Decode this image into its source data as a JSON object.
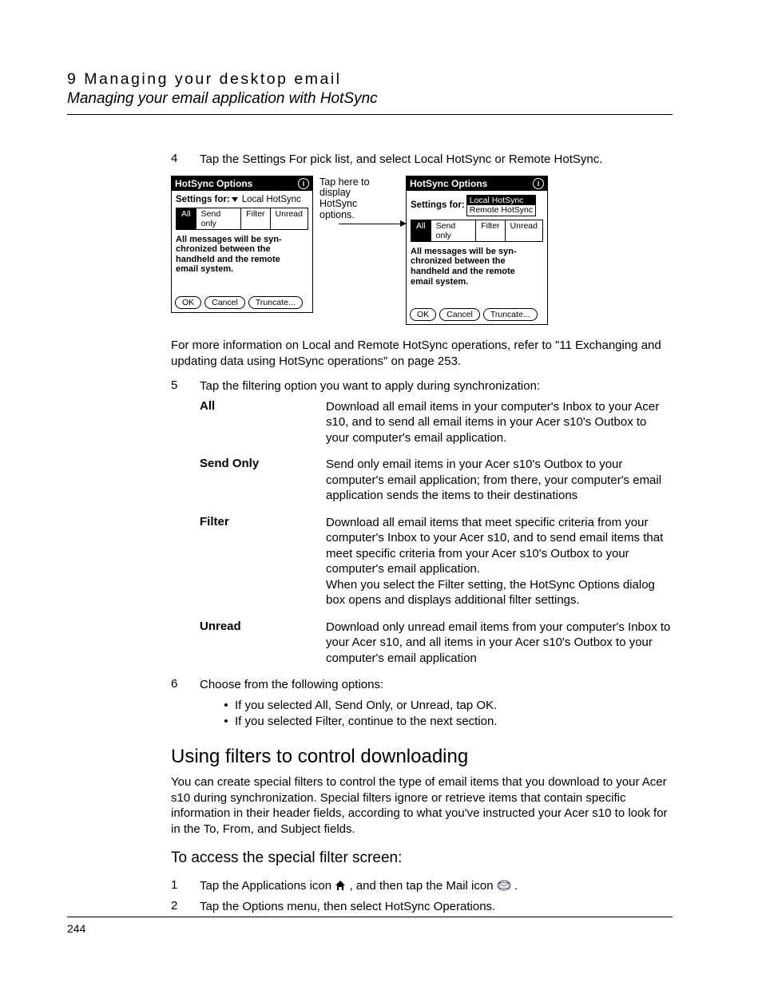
{
  "header": {
    "chapter": "9 Managing your desktop email",
    "sub": "Managing your email application with HotSync"
  },
  "step4": {
    "num": "4",
    "text": "Tap the Settings For pick list, and select Local HotSync or Remote HotSync."
  },
  "device": {
    "title": "HotSync Options",
    "settings_label": "Settings for:",
    "picklist_value": "Local HotSync",
    "dropdown": {
      "opt1": "Local HotSync",
      "opt2": "Remote HotSync"
    },
    "tabs": {
      "all": "All",
      "send": "Send only",
      "filter": "Filter",
      "unread": "Unread"
    },
    "msg": "All messages will be syn-\nchronized between the\nhandheld and the remote\nemail system.",
    "buttons": {
      "ok": "OK",
      "cancel": "Cancel",
      "truncate": "Truncate..."
    }
  },
  "callout": "Tap here to display HotSync options.",
  "para_after_shots": "For more information on Local and Remote HotSync operations, refer to \"11 Exchanging and updating data using HotSync operations\" on page 253.",
  "step5": {
    "num": "5",
    "text": "Tap the filtering option you want to apply during synchronization:"
  },
  "defs": {
    "all": {
      "term": "All",
      "desc": "Download all email items in your computer's Inbox to your Acer s10, and to send all email items in your Acer s10's Outbox to your computer's email application."
    },
    "send": {
      "term": "Send Only",
      "desc": "Send only email items in your Acer s10's Outbox to your computer's email application; from there, your computer's email application sends the items to their destinations"
    },
    "filter": {
      "term": "Filter",
      "desc1": "Download all email items that meet specific criteria from your computer's Inbox to your Acer s10, and to send email items that meet specific criteria from your Acer s10's Outbox to your computer's email application.",
      "desc2": "When you select the Filter setting, the HotSync Options dialog box opens and displays additional filter settings."
    },
    "unread": {
      "term": "Unread",
      "desc": "Download only unread email items from your computer's Inbox to your Acer s10, and all items in your Acer s10's Outbox to your computer's email application"
    }
  },
  "step6": {
    "num": "6",
    "text": "Choose from the following options:",
    "b1": "If you selected All, Send Only, or Unread, tap OK.",
    "b2": "If you selected Filter, continue to the next section."
  },
  "section": {
    "title": "Using filters to control downloading",
    "para": "You can create special filters to control the type of email items that you download to your Acer s10 during synchronization. Special filters ignore or retrieve items that contain specific information in their header fields, according to what you've instructed your Acer s10 to look for in the To, From, and Subject fields."
  },
  "sub": {
    "title": "To access the special filter screen:"
  },
  "substep1": {
    "num": "1",
    "t1": "Tap the Applications icon ",
    "t2": ", and then tap the Mail icon ",
    "t3": "."
  },
  "substep2": {
    "num": "2",
    "text": "Tap the Options menu, then select HotSync Operations."
  },
  "page_number": "244"
}
